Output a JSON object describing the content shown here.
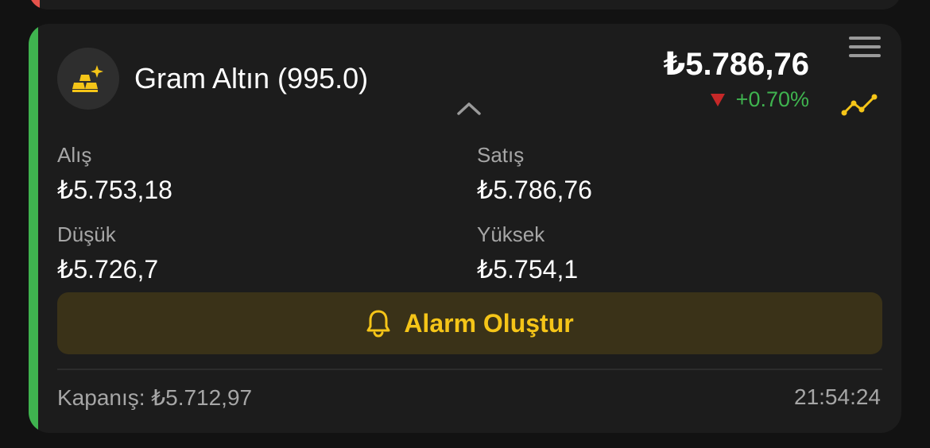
{
  "colors": {
    "card_accent": "#3fb34f",
    "prev_card_accent": "#e5534b",
    "gold": "#f5c518",
    "positive": "#3fb34f",
    "down_arrow": "#c62828",
    "alarm_bg": "#3a3218"
  },
  "asset": {
    "icon": "gold-bars-icon",
    "title": "Gram Altın (995.0)",
    "price": "₺5.786,76",
    "change": "+0.70%",
    "change_direction_icon": "down-triangle-icon"
  },
  "stats": {
    "buy_label": "Alış",
    "buy_value": "₺5.753,18",
    "sell_label": "Satış",
    "sell_value": "₺5.786,76",
    "low_label": "Düşük",
    "low_value": "₺5.726,7",
    "high_label": "Yüksek",
    "high_value": "₺5.754,1"
  },
  "actions": {
    "alarm_label": "Alarm Oluştur",
    "alarm_icon": "bell-icon",
    "menu_icon": "hamburger-menu-icon",
    "chart_icon": "trend-line-icon",
    "collapse_icon": "chevron-up-icon"
  },
  "footer": {
    "close_text": "Kapanış: ₺5.712,97",
    "time": "21:54:24"
  }
}
